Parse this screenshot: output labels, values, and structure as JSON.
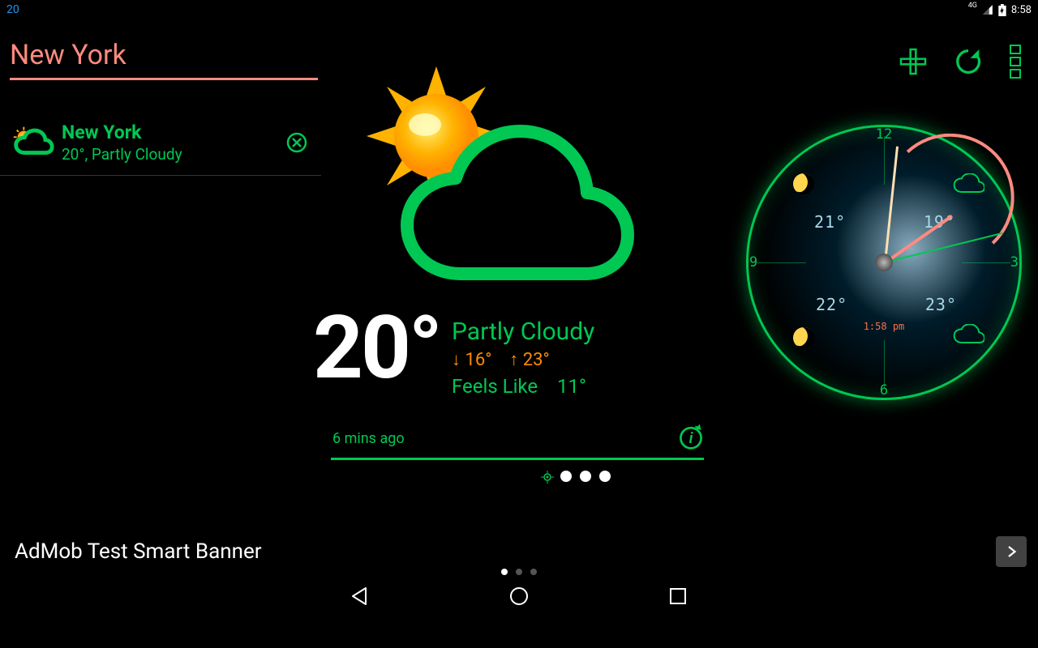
{
  "statusbar": {
    "left": "20",
    "net": "4G",
    "time": "8:58"
  },
  "header": {
    "city": "New York"
  },
  "actions": {
    "add": "add",
    "refresh": "refresh",
    "menu": "menu"
  },
  "cities": [
    {
      "name": "New York",
      "summary": "20°, Partly Cloudy"
    }
  ],
  "current": {
    "temp": "20°",
    "condition": "Partly Cloudy",
    "low_arrow": "↓",
    "low": "16°",
    "high_arrow": "↑",
    "high": "23°",
    "feels_label": "Feels Like",
    "feels_val": "11°",
    "updated": "6 mins ago"
  },
  "clock": {
    "n12": "12",
    "n3": "3",
    "n6": "6",
    "n9": "9",
    "q_tl": "21°",
    "q_tr": "19°",
    "q_bl": "22°",
    "q_br": "23°",
    "subtime": "1:58 pm"
  },
  "ad": {
    "text": "AdMob Test Smart Banner"
  }
}
